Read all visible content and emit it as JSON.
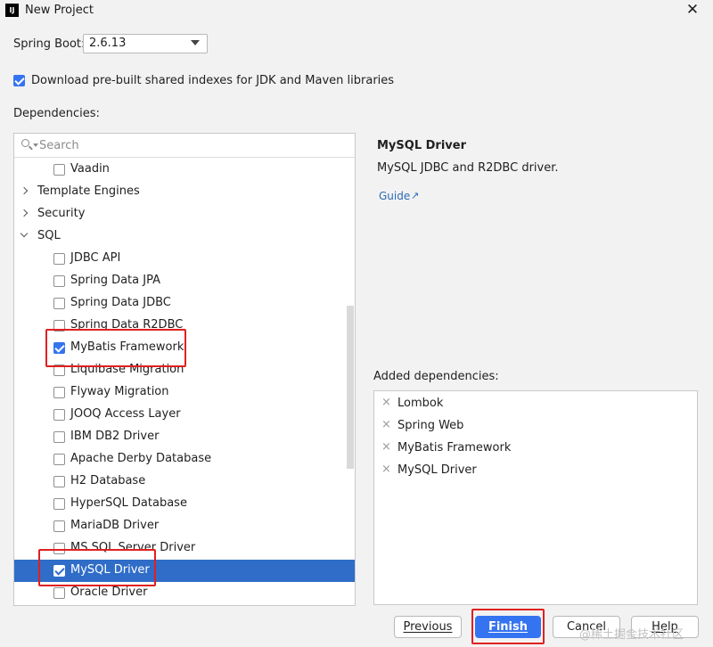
{
  "window": {
    "title": "New Project",
    "app_icon": "IJ",
    "close_glyph": "✕"
  },
  "spring_boot": {
    "label": "Spring Boot:",
    "value": "2.6.13"
  },
  "download_indexes": {
    "label": "Download pre-built shared indexes for JDK and Maven libraries",
    "checked": true
  },
  "dependencies": {
    "label": "Dependencies:",
    "search_placeholder": "Search",
    "rows": [
      {
        "type": "item",
        "label": "Vaadin",
        "checked": false
      },
      {
        "type": "category",
        "label": "Template Engines",
        "expanded": false
      },
      {
        "type": "category",
        "label": "Security",
        "expanded": false
      },
      {
        "type": "category",
        "label": "SQL",
        "expanded": true
      },
      {
        "type": "item",
        "label": "JDBC API",
        "checked": false
      },
      {
        "type": "item",
        "label": "Spring Data JPA",
        "checked": false
      },
      {
        "type": "item",
        "label": "Spring Data JDBC",
        "checked": false
      },
      {
        "type": "item",
        "label": "Spring Data R2DBC",
        "checked": false
      },
      {
        "type": "item",
        "label": "MyBatis Framework",
        "checked": true
      },
      {
        "type": "item",
        "label": "Liquibase Migration",
        "checked": false
      },
      {
        "type": "item",
        "label": "Flyway Migration",
        "checked": false
      },
      {
        "type": "item",
        "label": "JOOQ Access Layer",
        "checked": false
      },
      {
        "type": "item",
        "label": "IBM DB2 Driver",
        "checked": false
      },
      {
        "type": "item",
        "label": "Apache Derby Database",
        "checked": false
      },
      {
        "type": "item",
        "label": "H2 Database",
        "checked": false
      },
      {
        "type": "item",
        "label": "HyperSQL Database",
        "checked": false
      },
      {
        "type": "item",
        "label": "MariaDB Driver",
        "checked": false
      },
      {
        "type": "item",
        "label": "MS SQL Server Driver",
        "checked": false
      },
      {
        "type": "item",
        "label": "MySQL Driver",
        "checked": true,
        "selected": true
      },
      {
        "type": "item",
        "label": "Oracle Driver",
        "checked": false
      }
    ]
  },
  "info": {
    "title": "MySQL Driver",
    "description": "MySQL JDBC and R2DBC driver.",
    "guide_label": "Guide",
    "guide_arrow": "↗"
  },
  "added": {
    "label": "Added dependencies:",
    "remove_glyph": "×",
    "items": [
      "Lombok",
      "Spring Web",
      "MyBatis Framework",
      "MySQL Driver"
    ]
  },
  "buttons": {
    "previous": "Previous",
    "finish": "Finish",
    "cancel": "Cancel",
    "help": "Help"
  },
  "watermark": "@稀土掘金技术社区",
  "colors": {
    "accent": "#3574f0",
    "selection": "#2f6dc8",
    "highlight_box": "#e02020",
    "link": "#2a6ab8"
  }
}
